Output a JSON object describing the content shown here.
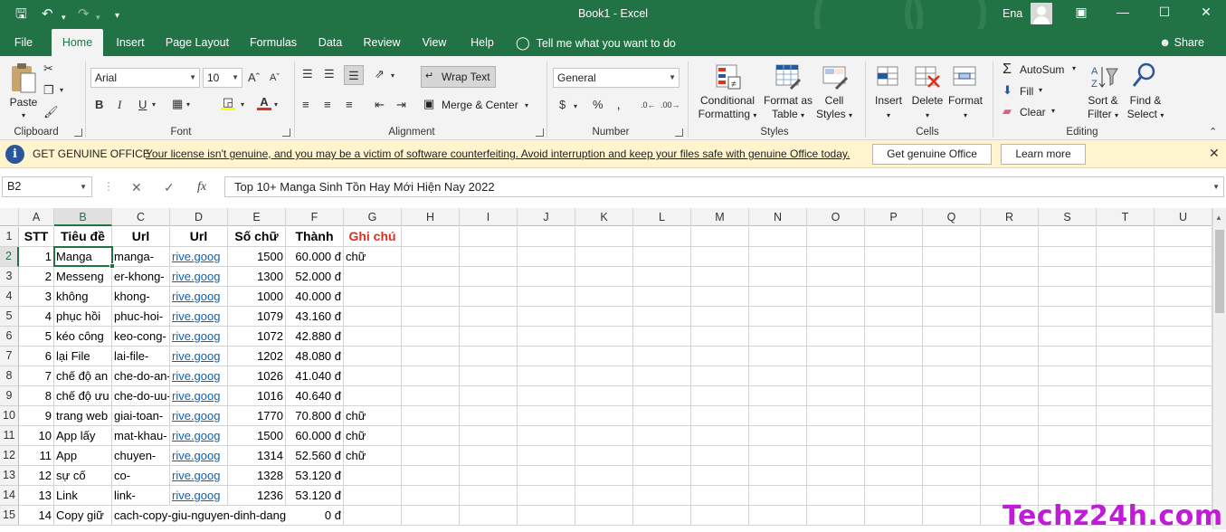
{
  "window": {
    "title": "Book1  -  Excel",
    "user": "Ena"
  },
  "tabs": [
    "File",
    "Home",
    "Insert",
    "Page Layout",
    "Formulas",
    "Data",
    "Review",
    "View",
    "Help"
  ],
  "tell_me": "Tell me what you want to do",
  "share": "Share",
  "ribbon": {
    "clipboard": {
      "label": "Clipboard",
      "paste": "Paste"
    },
    "font": {
      "label": "Font",
      "family": "Arial",
      "size": "10"
    },
    "alignment": {
      "label": "Alignment",
      "wrap_text": "Wrap Text",
      "merge_center": "Merge & Center"
    },
    "number": {
      "label": "Number",
      "format": "General"
    },
    "styles": {
      "label": "Styles",
      "conditional": [
        "Conditional",
        "Formatting"
      ],
      "format_table": [
        "Format as",
        "Table"
      ],
      "cell_styles": [
        "Cell",
        "Styles"
      ]
    },
    "cells": {
      "label": "Cells",
      "insert": "Insert",
      "delete": "Delete",
      "format": "Format"
    },
    "editing": {
      "label": "Editing",
      "autosum": "AutoSum",
      "fill": "Fill",
      "clear": "Clear",
      "sort": [
        "Sort &",
        "Filter"
      ],
      "find": [
        "Find &",
        "Select"
      ]
    }
  },
  "message_bar": {
    "title": "GET GENUINE OFFICE",
    "text": "Your license isn't genuine, and you may be a victim of software counterfeiting. Avoid interruption and keep your files safe with genuine Office today.",
    "btn_genuine": "Get genuine Office",
    "btn_learn": "Learn more"
  },
  "formula_bar": {
    "name_box": "B2",
    "formula": "Top 10+ Manga Sinh Tồn Hay Mới Hiện Nay 2022"
  },
  "columns": [
    "A",
    "B",
    "C",
    "D",
    "E",
    "F",
    "G",
    "H",
    "I",
    "J",
    "K",
    "L",
    "M",
    "N",
    "O",
    "P",
    "Q",
    "R",
    "S",
    "T",
    "U"
  ],
  "rows": [
    "1",
    "2",
    "3",
    "4",
    "5",
    "6",
    "7",
    "8",
    "9",
    "10",
    "11",
    "12",
    "13",
    "14",
    "15"
  ],
  "header_row": [
    "STT",
    "Tiêu đề",
    "Url",
    "Url",
    "Số chữ",
    "Thành",
    "Ghi chú"
  ],
  "data_rows": [
    [
      "1",
      "Manga",
      "manga-",
      "rive.goog",
      "1500",
      "60.000 đ",
      "chữ"
    ],
    [
      "2",
      "Messeng",
      "er-khong-",
      "rive.goog",
      "1300",
      "52.000 đ",
      ""
    ],
    [
      "3",
      "không",
      "khong-",
      "rive.goog",
      "1000",
      "40.000 đ",
      ""
    ],
    [
      "4",
      "phục hồi",
      "phuc-hoi-",
      "rive.goog",
      "1079",
      "43.160 đ",
      ""
    ],
    [
      "5",
      "kéo công",
      "keo-cong-",
      "rive.goog",
      "1072",
      "42.880 đ",
      ""
    ],
    [
      "6",
      "lại File",
      "lai-file-",
      "rive.goog",
      "1202",
      "48.080 đ",
      ""
    ],
    [
      "7",
      "chế độ an",
      "che-do-an-",
      "rive.goog",
      "1026",
      "41.040 đ",
      ""
    ],
    [
      "8",
      "chế độ ưu",
      "che-do-uu-",
      "rive.goog",
      "1016",
      "40.640 đ",
      ""
    ],
    [
      "9",
      "trang web",
      "giai-toan-",
      "rive.goog",
      "1770",
      "70.800 đ",
      "chữ"
    ],
    [
      "10",
      "App lấy",
      "mat-khau-",
      "rive.goog",
      "1500",
      "60.000 đ",
      "chữ"
    ],
    [
      "11",
      "App",
      "chuyen-",
      "rive.goog",
      "1314",
      "52.560 đ",
      "chữ"
    ],
    [
      "12",
      "sự cố",
      "co-",
      "rive.goog",
      "1328",
      "53.120 đ",
      ""
    ],
    [
      "13",
      "Link",
      "link-",
      "rive.goog",
      "1236",
      "53.120 đ",
      ""
    ],
    [
      "14",
      "Copy giữ",
      "cach-copy-giu-nguyen-dinh-dang",
      "",
      "",
      "0 đ",
      ""
    ]
  ],
  "watermark": "Techz24h.com"
}
